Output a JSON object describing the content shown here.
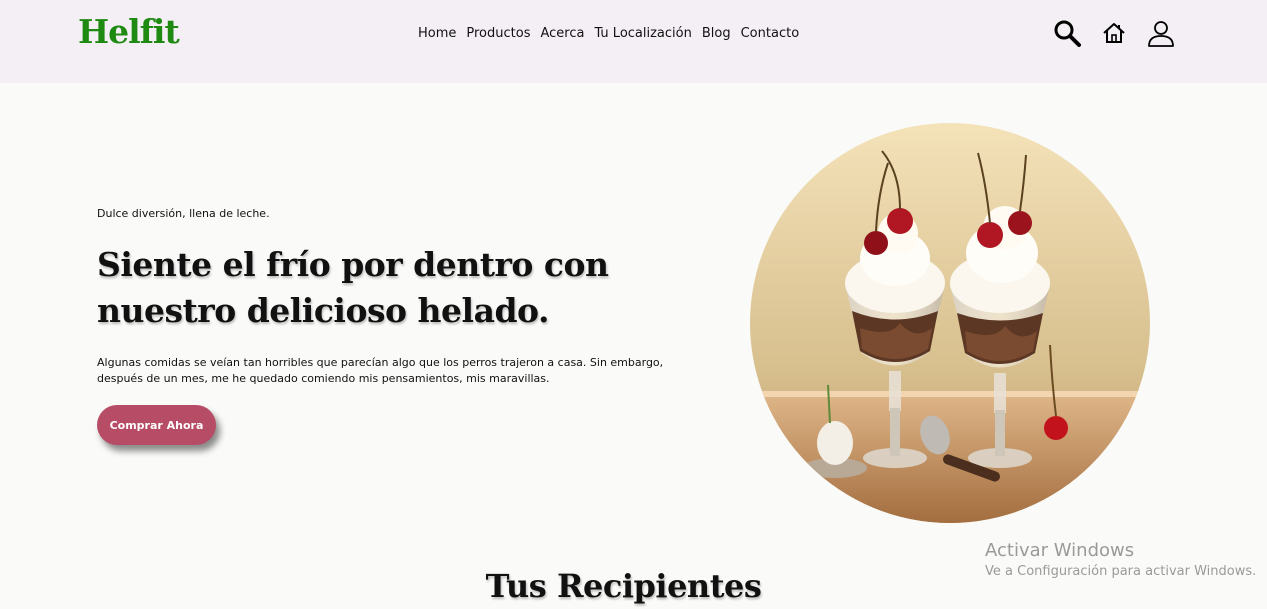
{
  "header": {
    "logo": "Helfit",
    "nav": [
      "Home",
      "Productos",
      "Acerca",
      "Tu Localización",
      "Blog",
      "Contacto"
    ],
    "icons": [
      "search-icon",
      "home-icon",
      "user-icon"
    ]
  },
  "hero": {
    "tagline": "Dulce diversión, llena de leche.",
    "title": "Siente el frío por dentro con nuestro delicioso helado.",
    "text": "Algunas comidas se veían tan horribles que parecían algo que los perros trajeron a casa. Sin embargo, después de un mes, me he quedado comiendo mis pensamientos, mis maravillas.",
    "button": "Comprar Ahora",
    "image": "ice-cream-sundae-photo"
  },
  "section": {
    "title": "Tus Recipientes"
  },
  "os_overlay": {
    "title": "Activar Windows",
    "subtitle": "Ve a Configuración para activar Windows."
  },
  "colors": {
    "nav_background": "#f4eff5",
    "logo_green": "#1f8a12",
    "button": "#b64c65",
    "page_background": "#fafaf8"
  }
}
